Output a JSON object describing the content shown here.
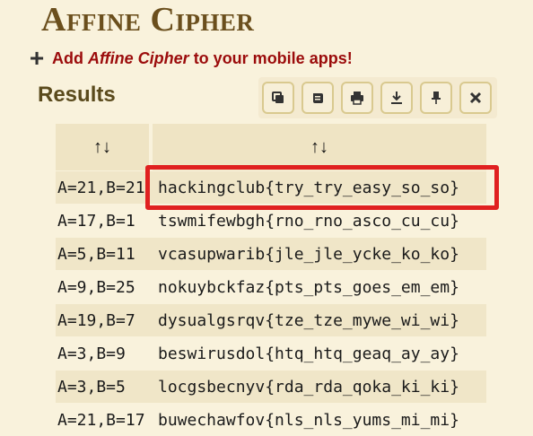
{
  "title": "Affine Cipher",
  "promo": {
    "prefix": "Add ",
    "app_name": "Affine Cipher",
    "suffix": " to your mobile apps!"
  },
  "results": {
    "heading": "Results",
    "toolbar": [
      "copy-icon",
      "scroll-icon",
      "print-icon",
      "download-icon",
      "pin-icon",
      "close-icon"
    ],
    "columns": [
      {
        "sort_label": "↑↓"
      },
      {
        "sort_label": "↑↓"
      }
    ],
    "rows": [
      {
        "key": "A=21,B=21",
        "value": "hackingclub{try_try_easy_so_so}"
      },
      {
        "key": "A=17,B=1",
        "value": "tswmifewbgh{rno_rno_asco_cu_cu}"
      },
      {
        "key": "A=5,B=11",
        "value": "vcasupwarib{jle_jle_ycke_ko_ko}"
      },
      {
        "key": "A=9,B=25",
        "value": "nokuybckfaz{pts_pts_goes_em_em}"
      },
      {
        "key": "A=19,B=7",
        "value": "dysualgsrqv{tze_tze_mywe_wi_wi}"
      },
      {
        "key": "A=3,B=9",
        "value": "beswirusdol{htq_htq_geaq_ay_ay}"
      },
      {
        "key": "A=3,B=5",
        "value": "locgsbecnyv{rda_rda_qoka_ki_ki}"
      },
      {
        "key": "A=21,B=17",
        "value": "buwechawfov{nls_nls_yums_mi_mi}"
      }
    ]
  },
  "colors": {
    "accent": "#9b0b0b",
    "title": "#6b4f1d",
    "highlight": "#e02020"
  }
}
